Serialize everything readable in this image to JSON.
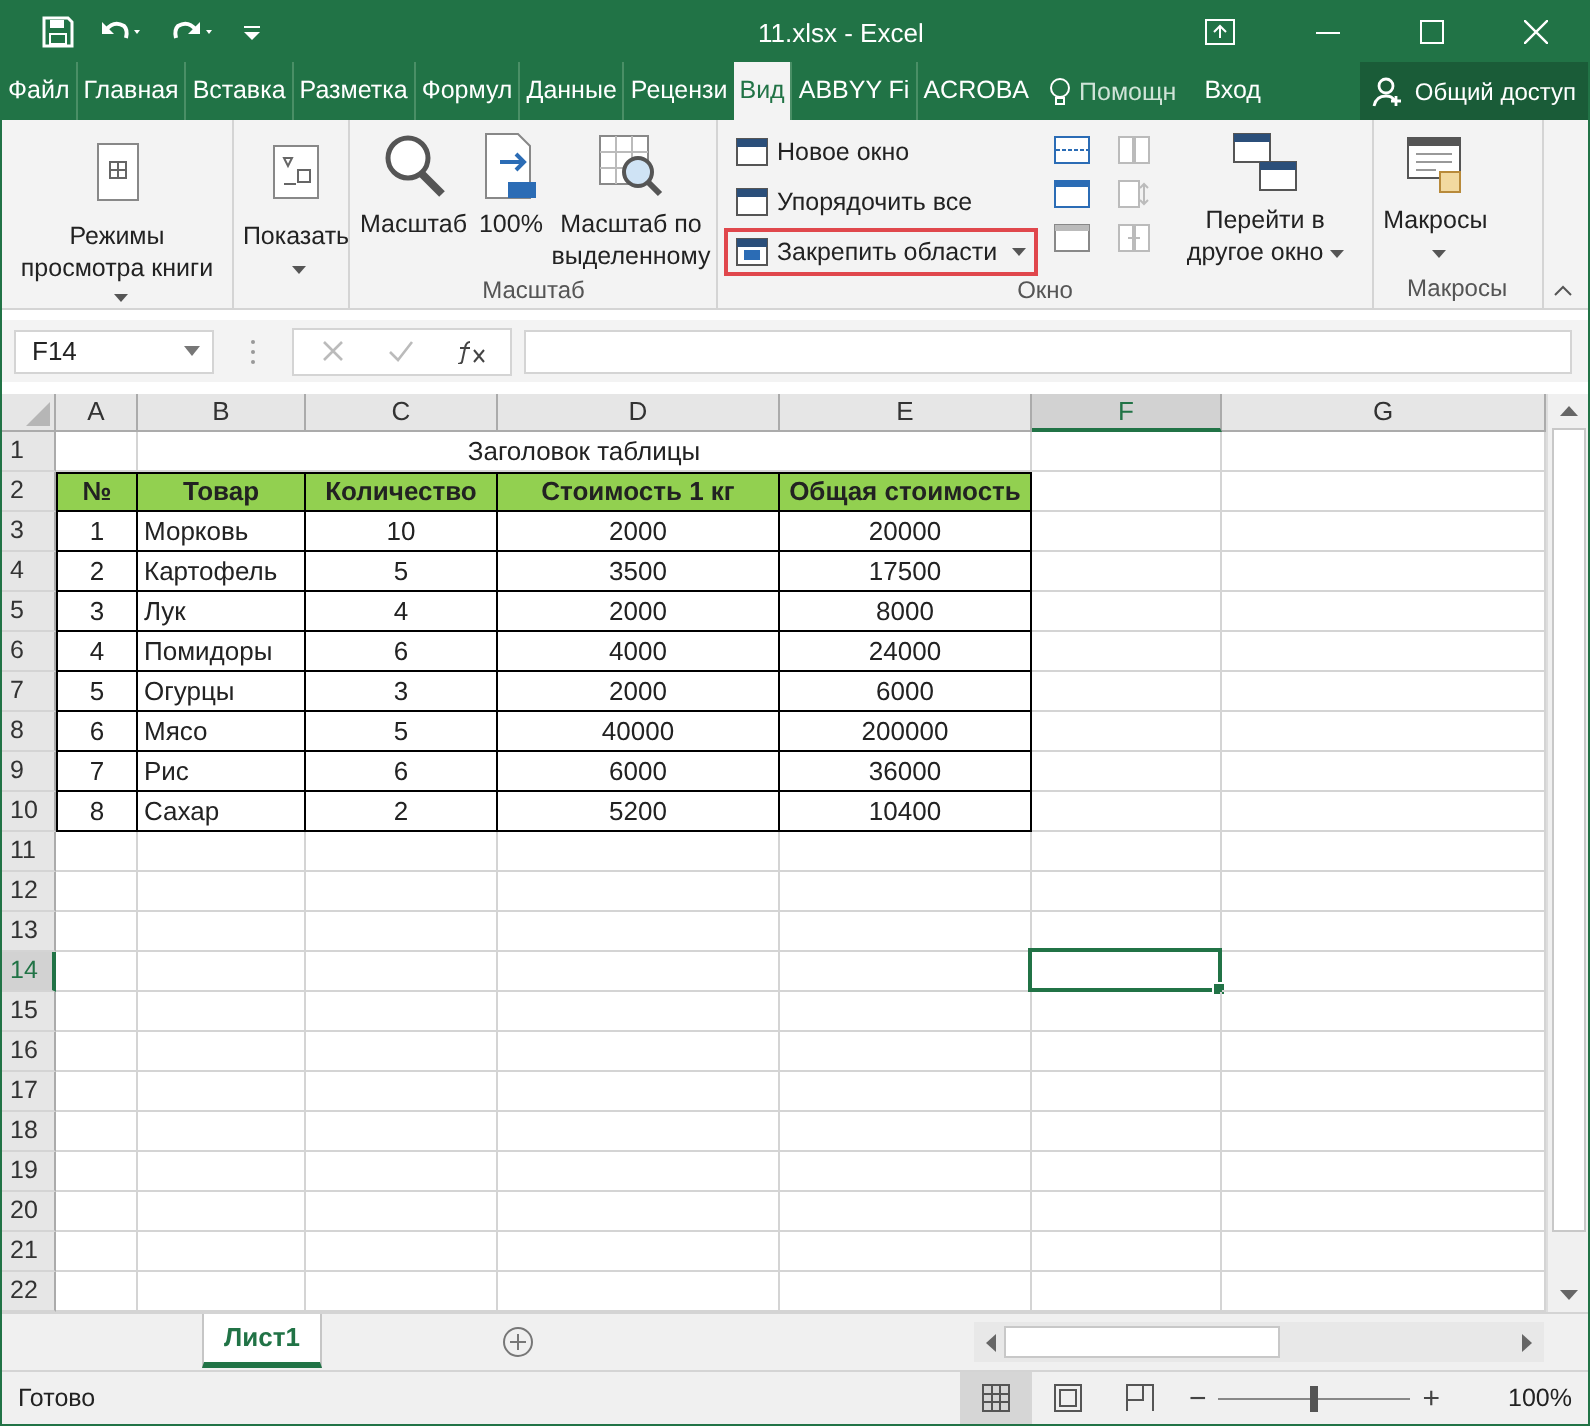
{
  "window": {
    "title": "11.xlsx - Excel"
  },
  "ribbon_tabs": [
    {
      "label": "Файл",
      "selected": false
    },
    {
      "label": "Главная",
      "selected": false
    },
    {
      "label": "Вставка",
      "selected": false
    },
    {
      "label": "Разметка",
      "selected": false
    },
    {
      "label": "Формул",
      "selected": false
    },
    {
      "label": "Данные",
      "selected": false
    },
    {
      "label": "Рецензи",
      "selected": false
    },
    {
      "label": "Вид",
      "selected": true
    },
    {
      "label": "ABBYY Fi",
      "selected": false
    },
    {
      "label": "ACROBA",
      "selected": false
    }
  ],
  "tell_me": "Помощн",
  "sign_in": "Вход",
  "share": "Общий доступ",
  "ribbon": {
    "groups": [
      {
        "buttons": [
          {
            "label": "Режимы просмотра книги",
            "dropdown": true
          }
        ]
      },
      {
        "buttons": [
          {
            "label": "Показать",
            "dropdown": true
          }
        ]
      },
      {
        "caption": "Масштаб",
        "buttons": [
          {
            "label": "Масштаб"
          },
          {
            "label": "100%"
          },
          {
            "label": "Масштаб по выделенному"
          }
        ]
      },
      {
        "caption": "Окно",
        "buttons": [
          {
            "label": "Новое окно",
            "dropdown": false
          },
          {
            "label": "Упорядочить все",
            "dropdown": false
          },
          {
            "label": "Закрепить области",
            "dropdown": true,
            "highlighted": true
          },
          {
            "label": "Перейти в другое окно",
            "dropdown": true
          }
        ]
      },
      {
        "caption": "Макросы",
        "buttons": [
          {
            "label": "Макросы",
            "dropdown": true
          }
        ]
      }
    ]
  },
  "name_box": "F14",
  "sheet": {
    "columns": [
      {
        "letter": "A",
        "selected": false
      },
      {
        "letter": "B",
        "selected": false
      },
      {
        "letter": "C",
        "selected": false
      },
      {
        "letter": "D",
        "selected": false
      },
      {
        "letter": "E",
        "selected": false
      },
      {
        "letter": "F",
        "selected": true
      },
      {
        "letter": "G",
        "selected": false
      }
    ],
    "rows": [
      {
        "number": "1",
        "kind": "title",
        "selected": false,
        "title": "Заголовок таблицы"
      },
      {
        "number": "2",
        "kind": "header",
        "selected": false,
        "cells": [
          "№",
          "Товар",
          "Количество",
          "Стоимость 1 кг",
          "Общая стоимость"
        ]
      },
      {
        "number": "3",
        "kind": "data",
        "selected": false,
        "cells": [
          "1",
          "Морковь",
          "10",
          "2000",
          "20000"
        ]
      },
      {
        "number": "4",
        "kind": "data",
        "selected": false,
        "cells": [
          "2",
          "Картофель",
          "5",
          "3500",
          "17500"
        ]
      },
      {
        "number": "5",
        "kind": "data",
        "selected": false,
        "cells": [
          "3",
          "Лук",
          "4",
          "2000",
          "8000"
        ]
      },
      {
        "number": "6",
        "kind": "data",
        "selected": false,
        "cells": [
          "4",
          "Помидоры",
          "6",
          "4000",
          "24000"
        ]
      },
      {
        "number": "7",
        "kind": "data",
        "selected": false,
        "cells": [
          "5",
          "Огурцы",
          "3",
          "2000",
          "6000"
        ]
      },
      {
        "number": "8",
        "kind": "data",
        "selected": false,
        "cells": [
          "6",
          "Мясо",
          "5",
          "40000",
          "200000"
        ]
      },
      {
        "number": "9",
        "kind": "data",
        "selected": false,
        "cells": [
          "7",
          "Рис",
          "6",
          "6000",
          "36000"
        ]
      },
      {
        "number": "10",
        "kind": "data",
        "selected": false,
        "cells": [
          "8",
          "Сахар",
          "2",
          "5200",
          "10400"
        ]
      },
      {
        "number": "11",
        "kind": "empty",
        "selected": false
      },
      {
        "number": "12",
        "kind": "empty",
        "selected": false
      },
      {
        "number": "13",
        "kind": "empty",
        "selected": false
      },
      {
        "number": "14",
        "kind": "empty",
        "selected": true
      },
      {
        "number": "15",
        "kind": "empty",
        "selected": false
      },
      {
        "number": "16",
        "kind": "empty",
        "selected": false
      },
      {
        "number": "17",
        "kind": "empty",
        "selected": false
      },
      {
        "number": "18",
        "kind": "empty",
        "selected": false
      },
      {
        "number": "19",
        "kind": "empty",
        "selected": false
      },
      {
        "number": "20",
        "kind": "empty",
        "selected": false
      },
      {
        "number": "21",
        "kind": "empty",
        "selected": false
      },
      {
        "number": "22",
        "kind": "empty",
        "selected": false
      }
    ]
  },
  "sheet_tabs": [
    {
      "label": "Лист1",
      "selected": true
    }
  ],
  "status_bar": {
    "text": "Готово",
    "zoom_out": "−",
    "zoom_in": "+",
    "zoom": "100%",
    "zoom_level": {
      "level": 0.5
    },
    "views": [
      {
        "selected": true
      },
      {
        "selected": false
      },
      {
        "selected": false
      }
    ]
  }
}
